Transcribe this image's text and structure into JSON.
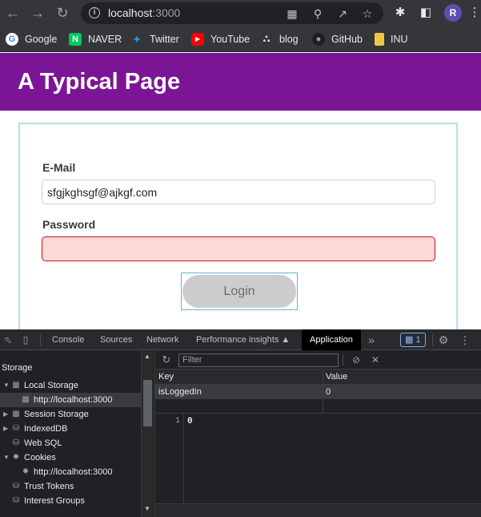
{
  "browser": {
    "url_host": "localhost",
    "url_port": ":3000",
    "profile_initial": "R",
    "bookmarks": [
      {
        "label": "Google",
        "icon": "google-icon",
        "color": "#4285f4"
      },
      {
        "label": "NAVER",
        "icon": "naver-icon",
        "color": "#03c75a"
      },
      {
        "label": "Twitter",
        "icon": "twitter-icon",
        "color": "#1d9bf0"
      },
      {
        "label": "YouTube",
        "icon": "youtube-icon",
        "color": "#ff0000"
      },
      {
        "label": "blog",
        "icon": "blog-icon",
        "color": "#e8eaed"
      },
      {
        "label": "GitHub",
        "icon": "github-icon",
        "color": "#e8eaed"
      },
      {
        "label": "INU",
        "icon": "folder-icon",
        "color": "#f2c744"
      }
    ]
  },
  "page": {
    "title": "A Typical Page",
    "header_color": "#7b1595",
    "form": {
      "email_label": "E-Mail",
      "email_value": "sfgjkghsgf@ajkgf.com",
      "password_label": "Password",
      "password_value": "",
      "login_label": "Login"
    }
  },
  "devtools": {
    "tabs": [
      "Console",
      "Sources",
      "Network",
      "Performance insights",
      "Application"
    ],
    "active_tab": "Application",
    "issues_count": "1",
    "sidebar_title": "Storage",
    "sidebar": [
      {
        "label": "Local Storage",
        "expanded": true
      },
      {
        "label": "http://localhost:3000",
        "child": true,
        "selected": true
      },
      {
        "label": "Session Storage"
      },
      {
        "label": "IndexedDB"
      },
      {
        "label": "Web SQL"
      },
      {
        "label": "Cookies",
        "expanded": true
      },
      {
        "label": "http://localhost:3000",
        "child": true
      },
      {
        "label": "Trust Tokens"
      },
      {
        "label": "Interest Groups"
      }
    ],
    "filter_placeholder": "Filter",
    "table": {
      "headers": [
        "Key",
        "Value"
      ],
      "rows": [
        {
          "key": "isLoggedIn",
          "value": "0"
        }
      ]
    },
    "preview": {
      "line_number": "1",
      "content": "0"
    }
  }
}
